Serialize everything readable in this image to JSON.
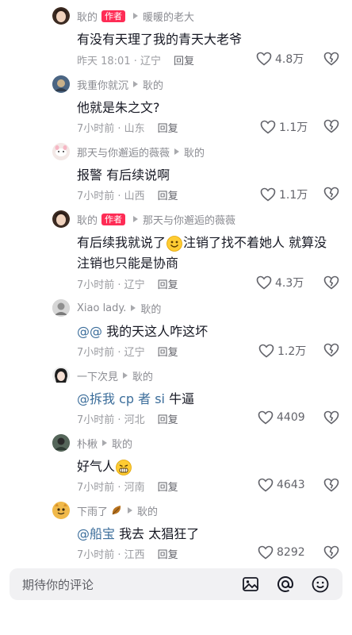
{
  "comments": [
    {
      "name": "耿的",
      "author_tag": "作者",
      "reply_to": "暖暖的老大",
      "text": "有没有天理了我的青天大老爷",
      "time": "昨天 18:01 · 辽宁",
      "reply": "回复",
      "likes": "4.8万"
    },
    {
      "name": "我重你就沉",
      "author_tag": "",
      "reply_to": "耿的",
      "text": "他就是朱之文?",
      "time": "7小时前 · 山东",
      "reply": "回复",
      "likes": "1.1万"
    },
    {
      "name": "那天与你邂逅的薇薇",
      "author_tag": "",
      "reply_to": "耿的",
      "text": "报警 有后续说啊",
      "time": "7小时前 · 山西",
      "reply": "回复",
      "likes": "1.1万"
    },
    {
      "name": "耿的",
      "author_tag": "作者",
      "reply_to": "那天与你邂逅的薇薇",
      "text_a": "有后续我就说了",
      "text_b": "注销了找不着她人 就算没",
      "text_c": "注销也只能是协商",
      "time": "7小时前 · 辽宁",
      "reply": "回复",
      "likes": "4.3万"
    },
    {
      "name": "Xiao lady.",
      "author_tag": "",
      "reply_to": "耿的",
      "mention": "@@",
      "text": " 我的天这人咋这坏",
      "time": "7小时前 · 辽宁",
      "reply": "回复",
      "likes": "1.2万"
    },
    {
      "name": "一下次見",
      "author_tag": "",
      "reply_to": "耿的",
      "mention": "@拆我 cp 者 si",
      "text": " 牛逼",
      "time": "7小时前 · 河北",
      "reply": "回复",
      "likes": "4409"
    },
    {
      "name": "朴楸",
      "author_tag": "",
      "reply_to": "耿的",
      "text": "好气人",
      "time": "7小时前 · 河南",
      "reply": "回复",
      "likes": "4643"
    },
    {
      "name": "下雨了",
      "author_tag": "",
      "reply_to": "耿的",
      "mention": "@船宝",
      "text": " 我去 太猖狂了",
      "time": "7小时前 · 江西",
      "reply": "回复",
      "likes": "8292"
    }
  ],
  "composer": {
    "placeholder": "期待你的评论"
  },
  "icons": {
    "like": "heart-outline-icon",
    "dislike": "broken-heart-icon",
    "image": "image-icon",
    "at": "at-icon",
    "emoji": "emoji-icon"
  },
  "colors": {
    "author_tag": "#fe2c55",
    "mention": "#3c6e9b"
  }
}
